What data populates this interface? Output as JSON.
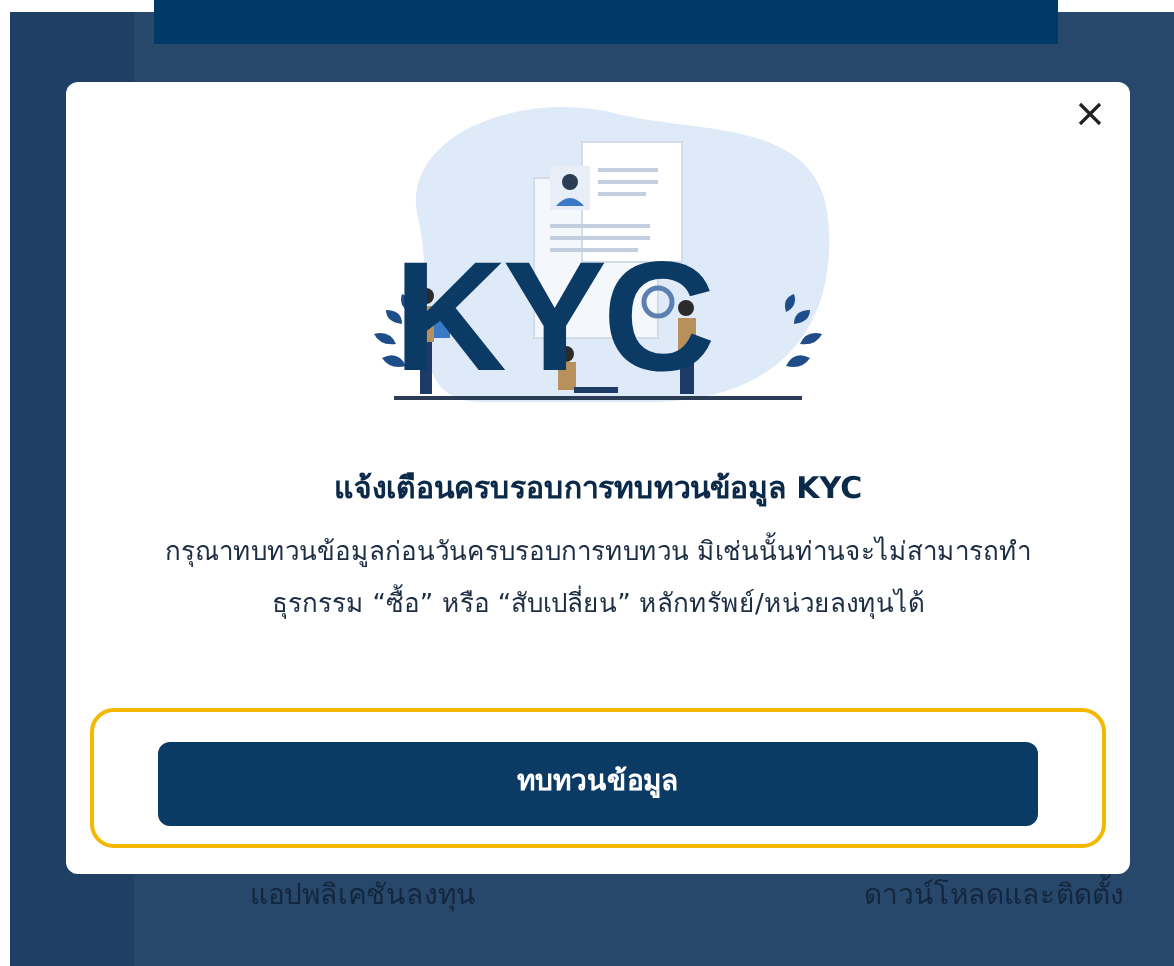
{
  "background": {
    "labels": [
      "แอปพลิเคชันลงทุน",
      "ดาวน์โหลดและติดตั้ง"
    ]
  },
  "modal": {
    "illustration_text": "KYC",
    "title": "แจ้งเตือนครบรอบการทบทวนข้อมูล KYC",
    "message": "กรุณาทบทวนข้อมูลก่อนวันครบรอบการทบทวน มิเช่นนั้นท่านจะไม่สามารถทำ ธุรกรรม “ซื้อ” หรือ “สับเปลี่ยน” หลักทรัพย์/หน่วยลงทุนได้",
    "button": {
      "label": "ทบทวนข้อมูล",
      "highlighted": true
    }
  }
}
